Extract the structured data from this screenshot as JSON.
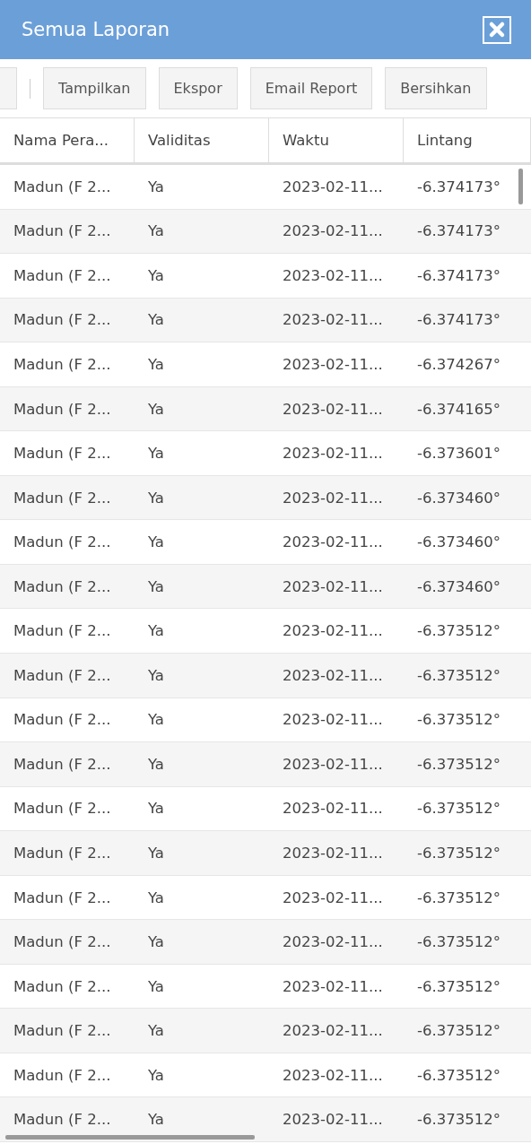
{
  "window": {
    "title": "Semua Laporan"
  },
  "toolbar": {
    "buttons": [
      {
        "label": "Tampilkan"
      },
      {
        "label": "Ekspor"
      },
      {
        "label": "Email Report"
      },
      {
        "label": "Bersihkan"
      }
    ]
  },
  "table": {
    "columns": [
      "Nama Pera...",
      "Validitas",
      "Waktu",
      "Lintang"
    ],
    "rows": [
      {
        "cells": [
          "Madun (F 2...",
          "Ya",
          "2023-02-11...",
          "-6.374173°"
        ]
      },
      {
        "cells": [
          "Madun (F 2...",
          "Ya",
          "2023-02-11...",
          "-6.374173°"
        ]
      },
      {
        "cells": [
          "Madun (F 2...",
          "Ya",
          "2023-02-11...",
          "-6.374173°"
        ]
      },
      {
        "cells": [
          "Madun (F 2...",
          "Ya",
          "2023-02-11...",
          "-6.374173°"
        ]
      },
      {
        "cells": [
          "Madun (F 2...",
          "Ya",
          "2023-02-11...",
          "-6.374267°"
        ]
      },
      {
        "cells": [
          "Madun (F 2...",
          "Ya",
          "2023-02-11...",
          "-6.374165°"
        ]
      },
      {
        "cells": [
          "Madun (F 2...",
          "Ya",
          "2023-02-11...",
          "-6.373601°"
        ]
      },
      {
        "cells": [
          "Madun (F 2...",
          "Ya",
          "2023-02-11...",
          "-6.373460°"
        ]
      },
      {
        "cells": [
          "Madun (F 2...",
          "Ya",
          "2023-02-11...",
          "-6.373460°"
        ]
      },
      {
        "cells": [
          "Madun (F 2...",
          "Ya",
          "2023-02-11...",
          "-6.373460°"
        ]
      },
      {
        "cells": [
          "Madun (F 2...",
          "Ya",
          "2023-02-11...",
          "-6.373512°"
        ]
      },
      {
        "cells": [
          "Madun (F 2...",
          "Ya",
          "2023-02-11...",
          "-6.373512°"
        ]
      },
      {
        "cells": [
          "Madun (F 2...",
          "Ya",
          "2023-02-11...",
          "-6.373512°"
        ]
      },
      {
        "cells": [
          "Madun (F 2...",
          "Ya",
          "2023-02-11...",
          "-6.373512°"
        ]
      },
      {
        "cells": [
          "Madun (F 2...",
          "Ya",
          "2023-02-11...",
          "-6.373512°"
        ]
      },
      {
        "cells": [
          "Madun (F 2...",
          "Ya",
          "2023-02-11...",
          "-6.373512°"
        ]
      },
      {
        "cells": [
          "Madun (F 2...",
          "Ya",
          "2023-02-11...",
          "-6.373512°"
        ]
      },
      {
        "cells": [
          "Madun (F 2...",
          "Ya",
          "2023-02-11...",
          "-6.373512°"
        ]
      },
      {
        "cells": [
          "Madun (F 2...",
          "Ya",
          "2023-02-11...",
          "-6.373512°"
        ]
      },
      {
        "cells": [
          "Madun (F 2...",
          "Ya",
          "2023-02-11...",
          "-6.373512°"
        ]
      },
      {
        "cells": [
          "Madun (F 2...",
          "Ya",
          "2023-02-11...",
          "-6.373512°"
        ]
      },
      {
        "cells": [
          "Madun (F 2...",
          "Ya",
          "2023-02-11...",
          "-6.373512°"
        ]
      }
    ]
  }
}
